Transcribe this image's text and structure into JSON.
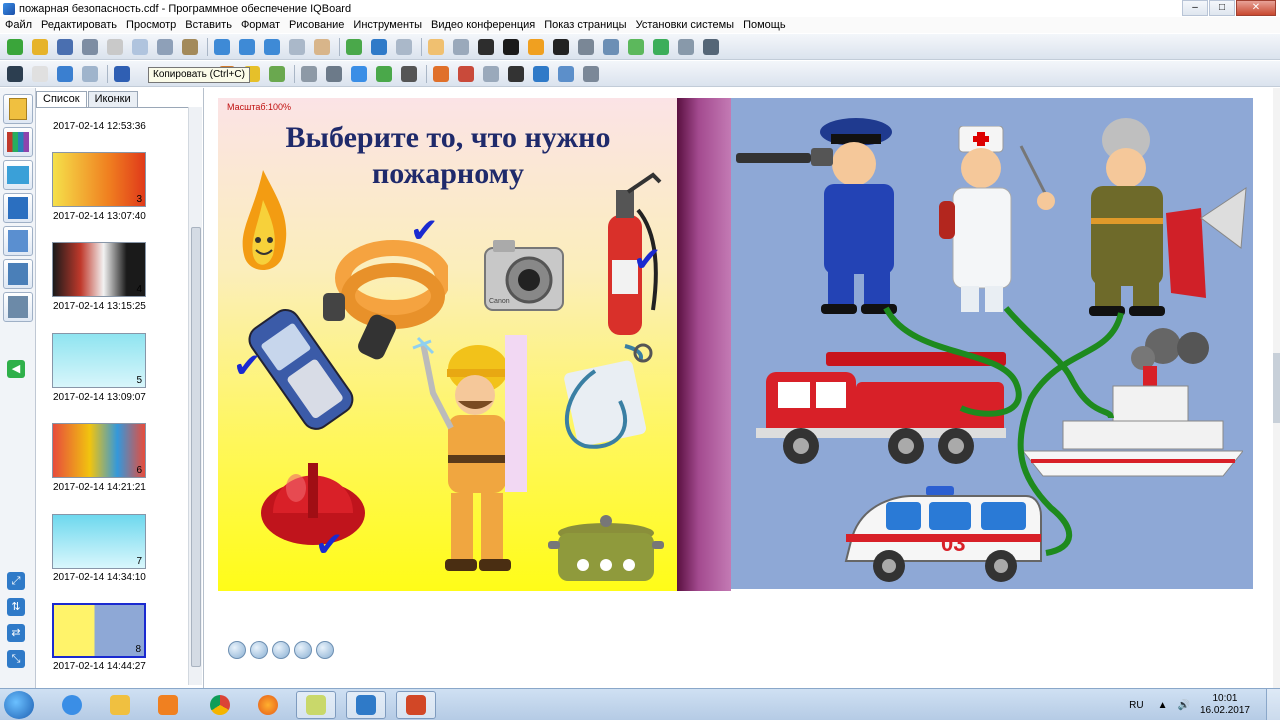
{
  "window": {
    "title": "пожарная безопасность.cdf - Программное обеспечение IQBoard",
    "controls": [
      "–",
      "□",
      "✕"
    ]
  },
  "menu": [
    "Файл",
    "Редактировать",
    "Просмотр",
    "Вставить",
    "Формат",
    "Рисование",
    "Инструменты",
    "Видео конференция",
    "Показ страницы",
    "Установки системы",
    "Помощь"
  ],
  "tooltip": "Копировать (Ctrl+C)",
  "panel": {
    "tabs": [
      "Список",
      "Иконки"
    ],
    "items": [
      {
        "time": "2017-02-14 12:53:36",
        "num": ""
      },
      {
        "time": "2017-02-14 13:07:40",
        "num": "3"
      },
      {
        "time": "2017-02-14 13:15:25",
        "num": "4"
      },
      {
        "time": "2017-02-14 13:09:07",
        "num": "5"
      },
      {
        "time": "2017-02-14 14:21:21",
        "num": "6"
      },
      {
        "time": "2017-02-14 14:34:10",
        "num": "7"
      },
      {
        "time": "2017-02-14 14:44:27",
        "num": "8"
      }
    ]
  },
  "slide": {
    "scale": "Масштаб:100%",
    "title": "Выберите то, что нужно пожарному",
    "check": "✔",
    "ambulance_number": "03",
    "camera_brand": "Canon"
  },
  "tray": {
    "lang": "RU",
    "time": "10:01",
    "date": "16.02.2017"
  }
}
